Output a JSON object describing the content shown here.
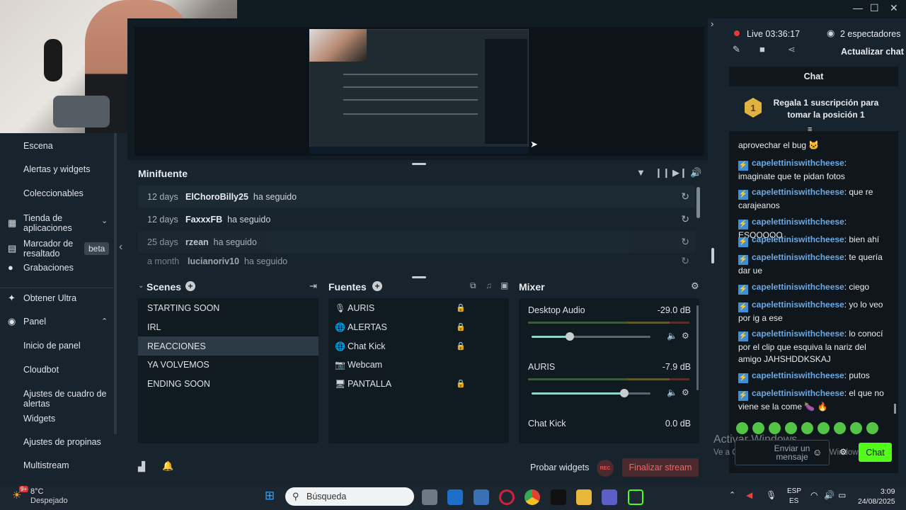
{
  "window": {
    "minimize": "—",
    "maximize": "☐",
    "close": "✕"
  },
  "sidebar": {
    "items": [
      {
        "label": "Escena",
        "icon": ""
      },
      {
        "label": "Alertas y widgets",
        "icon": ""
      },
      {
        "label": "Coleccionables",
        "icon": ""
      },
      {
        "label": "Tienda de aplicaciones",
        "icon": "store-icon",
        "chevron": "⌄"
      },
      {
        "label": "Marcador de resaltado",
        "icon": "highlight-icon",
        "badge": "beta"
      },
      {
        "label": "Grabaciones",
        "icon": "play-icon"
      },
      {
        "label": "Obtener Ultra",
        "icon": "ultra-icon"
      },
      {
        "label": "Panel",
        "icon": "panel-icon",
        "chevron": "⌃"
      },
      {
        "label": "Inicio de panel"
      },
      {
        "label": "Cloudbot"
      },
      {
        "label": "Ajustes de cuadro de alertas"
      },
      {
        "label": "Widgets"
      },
      {
        "label": "Ajustes de propinas"
      },
      {
        "label": "Multistream"
      }
    ]
  },
  "minifuente": {
    "title": "Minifuente",
    "rows": [
      {
        "time": "12 days",
        "name": "ElChoroBilly25",
        "action": "ha seguido"
      },
      {
        "time": "12 days",
        "name": "FaxxxFB",
        "action": "ha seguido"
      },
      {
        "time": "25 days",
        "name": "rzean",
        "action": "ha seguido"
      },
      {
        "time": "a month",
        "name": "lucianoriv10",
        "action": "ha seguido"
      }
    ]
  },
  "scenes": {
    "title": "Scenes",
    "items": [
      "STARTING SOON",
      "IRL",
      "REACCIONES",
      "YA VOLVEMOS",
      "ENDING SOON"
    ],
    "active": "REACCIONES"
  },
  "sources": {
    "title": "Fuentes",
    "items": [
      {
        "label": "AURIS",
        "icon": "🎙"
      },
      {
        "label": "ALERTAS",
        "icon": "🌐"
      },
      {
        "label": "Chat Kick",
        "icon": "🌐"
      },
      {
        "label": "Webcam",
        "icon": "📷"
      },
      {
        "label": "PANTALLA",
        "icon": "🖥"
      }
    ]
  },
  "mixer": {
    "title": "Mixer",
    "channels": [
      {
        "name": "Desktop Audio",
        "db": "-29.0 dB",
        "volume": 0.32
      },
      {
        "name": "AURIS",
        "db": "-7.9 dB",
        "volume": 0.78
      },
      {
        "name": "Chat Kick",
        "db": "0.0 dB"
      }
    ]
  },
  "bottom": {
    "test_widgets": "Probar widgets",
    "rec": "REC",
    "end_stream": "Finalizar stream"
  },
  "stream": {
    "live": "Live",
    "time": "03:36:17",
    "viewers": "2 espectadores",
    "refresh": "Actualizar chat"
  },
  "chat": {
    "title": "Chat",
    "gift": "Regala 1 suscripción para tomar la posición 1",
    "medal": "1",
    "first_msg": "aprovechar el bug",
    "messages": [
      {
        "user": "capelettiniswithcheese",
        "text": ": imaginate que te pidan fotos"
      },
      {
        "user": "capelettiniswithcheese",
        "text": ": que re carajeanos"
      },
      {
        "user": "capelettiniswithcheese",
        "text": ": ESOOOOO"
      },
      {
        "user": "capelettiniswithcheese",
        "text": ": bien ahí"
      },
      {
        "user": "capelettiniswithcheese",
        "text": ": te quería dar ue"
      },
      {
        "user": "capelettiniswithcheese",
        "text": ": ciego"
      },
      {
        "user": "capelettiniswithcheese",
        "text": ": yo lo veo por ig a ese"
      },
      {
        "user": "capelettiniswithcheese",
        "text": ": lo conocí por el clip que esquiva la nariz del amigo JAHSHDDKSKAJ"
      },
      {
        "user": "capelettiniswithcheese",
        "text": ": putos"
      },
      {
        "user": "capelettiniswithcheese",
        "text": ": el que no viene se la come 🍆 🔥"
      }
    ],
    "input_placeholder": "Enviar un mensaje",
    "send": "Chat"
  },
  "watermark": {
    "line1": "Activar Windows",
    "line2": "Ve a Configuración para activar Windows."
  },
  "taskbar": {
    "weather_temp": "8°C",
    "weather_desc": "Despejado",
    "weather_badge": "9+",
    "search": "Búsqueda",
    "lang1": "ESP",
    "lang2": "ES",
    "time": "3:09",
    "date": "24/08/2025"
  }
}
